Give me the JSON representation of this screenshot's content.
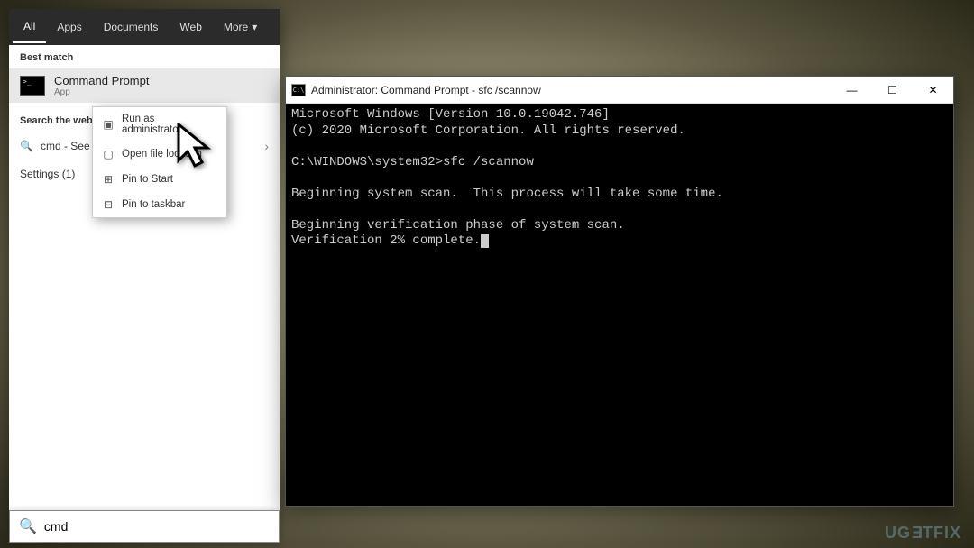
{
  "search": {
    "tabs": {
      "all": "All",
      "apps": "Apps",
      "documents": "Documents",
      "web": "Web",
      "more": "More"
    },
    "best_match_header": "Best match",
    "best_match": {
      "title": "Command Prompt",
      "subtitle": "App"
    },
    "search_web_header": "Search the web",
    "search_web_item": "cmd - See web results",
    "settings_line": "Settings (1)",
    "input_value": "cmd"
  },
  "context_menu": {
    "items": {
      "run_admin": "Run as administrator",
      "open_location": "Open file location",
      "pin_start": "Pin to Start",
      "pin_taskbar": "Pin to taskbar"
    }
  },
  "terminal": {
    "title": "Administrator: Command Prompt - sfc  /scannow",
    "lines": {
      "l1": "Microsoft Windows [Version 10.0.19042.746]",
      "l2": "(c) 2020 Microsoft Corporation. All rights reserved.",
      "l3": "",
      "l4": "C:\\WINDOWS\\system32>sfc /scannow",
      "l5": "",
      "l6": "Beginning system scan.  This process will take some time.",
      "l7": "",
      "l8": "Beginning verification phase of system scan.",
      "l9": "Verification 2% complete."
    }
  },
  "watermark": "UGETFIX"
}
